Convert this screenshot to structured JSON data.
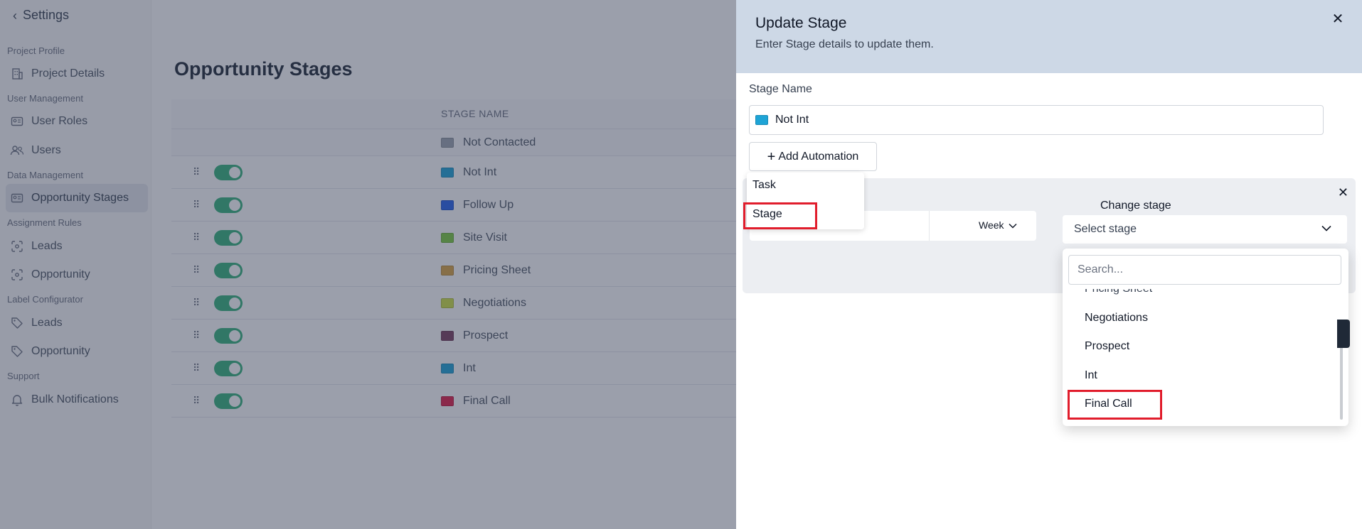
{
  "sidebar": {
    "back_label": "Settings",
    "sections": [
      {
        "label": "Project Profile"
      },
      {
        "label": "User Management"
      },
      {
        "label": "Data Management"
      },
      {
        "label": "Assignment Rules"
      },
      {
        "label": "Label Configurator"
      },
      {
        "label": "Support"
      }
    ],
    "items": [
      {
        "label": "Project Details",
        "icon": "building-icon"
      },
      {
        "label": "User Roles",
        "icon": "id-card-icon"
      },
      {
        "label": "Users",
        "icon": "users-icon"
      },
      {
        "label": "Opportunity Stages",
        "icon": "id-card-icon",
        "active": true
      },
      {
        "label": "Leads",
        "icon": "target-icon"
      },
      {
        "label": "Opportunity",
        "icon": "target-icon"
      },
      {
        "label": "Leads",
        "icon": "tag-icon"
      },
      {
        "label": "Opportunity",
        "icon": "tag-icon"
      },
      {
        "label": "Bulk Notifications",
        "icon": "bell-icon"
      }
    ]
  },
  "main": {
    "title": "Opportunity Stages",
    "column_header": "STAGE NAME",
    "rows": [
      {
        "name": "Not Contacted",
        "color": "#9ca3af"
      },
      {
        "name": "Not Int",
        "color": "#1ea4d6"
      },
      {
        "name": "Follow Up",
        "color": "#2563eb"
      },
      {
        "name": "Site Visit",
        "color": "#7ccb3f"
      },
      {
        "name": "Pricing Sheet",
        "color": "#d9a441"
      },
      {
        "name": "Negotiations",
        "color": "#cde043"
      },
      {
        "name": "Prospect",
        "color": "#7c3f5e"
      },
      {
        "name": "Int",
        "color": "#1ea4d6"
      },
      {
        "name": "Final Call",
        "color": "#e11d48"
      }
    ]
  },
  "drawer": {
    "title": "Update Stage",
    "subtitle": "Enter Stage details to update them.",
    "stage_name_label": "Stage Name",
    "stage_name_value": "Not Int",
    "stage_color": "#1ea4d6",
    "add_automation_label": "Add Automation",
    "automation_types": [
      "Task",
      "Stage"
    ],
    "period_value": "Week",
    "change_stage_label": "Change stage",
    "select_placeholder": "Select stage",
    "search_placeholder": "Search...",
    "options": [
      "Pricing Sheet",
      "Negotiations",
      "Prospect",
      "Int",
      "Final Call"
    ]
  },
  "colors": {
    "highlight": "#e11d2c",
    "toggle_on": "#34b27b",
    "header_bg": "#cdd8e6"
  }
}
